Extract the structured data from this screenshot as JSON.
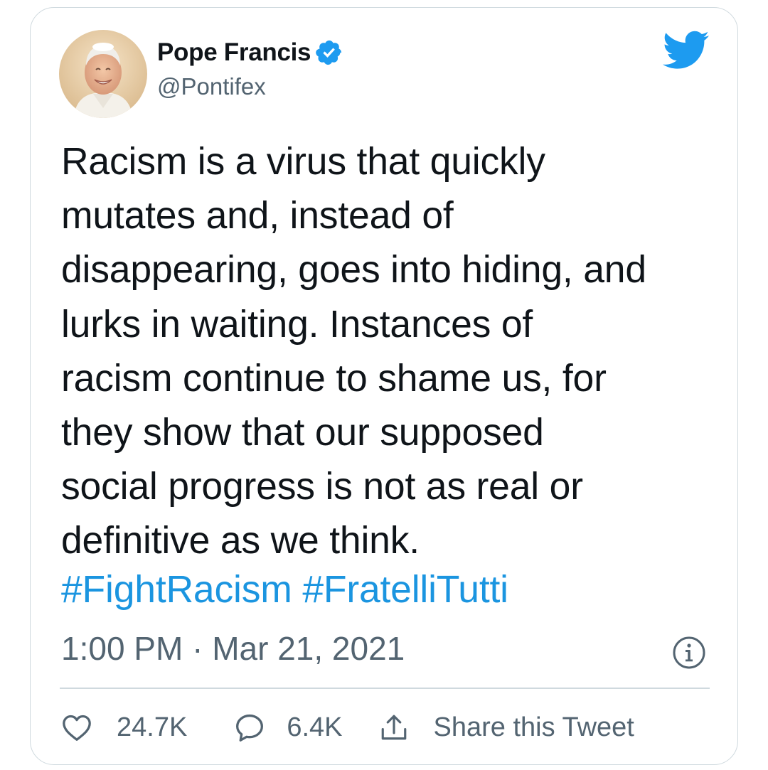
{
  "tweet": {
    "author": {
      "name": "Pope Francis",
      "handle": "@Pontifex",
      "verified": true
    },
    "text": "Racism is a virus that quickly mutates and, instead of disappearing, goes into hiding, and lurks in waiting. Instances of racism continue to shame us, for they show that our supposed social progress is not as real or definitive as we think.",
    "text_lines": [
      "Racism is a virus that quickly",
      "mutates and, instead of",
      "disappearing, goes into hiding, and",
      "lurks in waiting. Instances of",
      "racism continue to shame us, for",
      "they show that our supposed",
      "social progress is not as real or",
      "definitive as we think."
    ],
    "hashtags": [
      "#FightRacism",
      "#FratelliTutti"
    ],
    "timestamp": "1:00 PM · Mar 21, 2021",
    "actions": {
      "likes": "24.7K",
      "replies": "6.4K",
      "share_label": "Share this Tweet"
    }
  },
  "icons": {
    "platform_logo": "twitter-bird-icon",
    "verified": "verified-badge-icon",
    "info": "info-icon",
    "like": "heart-icon",
    "reply": "reply-bubble-icon",
    "share": "share-icon"
  },
  "colors": {
    "brand": "#1d9bf0",
    "hashtag": "#1b95e0",
    "text": "#0f1419",
    "secondary_text": "#536471",
    "border": "#cfd9de"
  }
}
